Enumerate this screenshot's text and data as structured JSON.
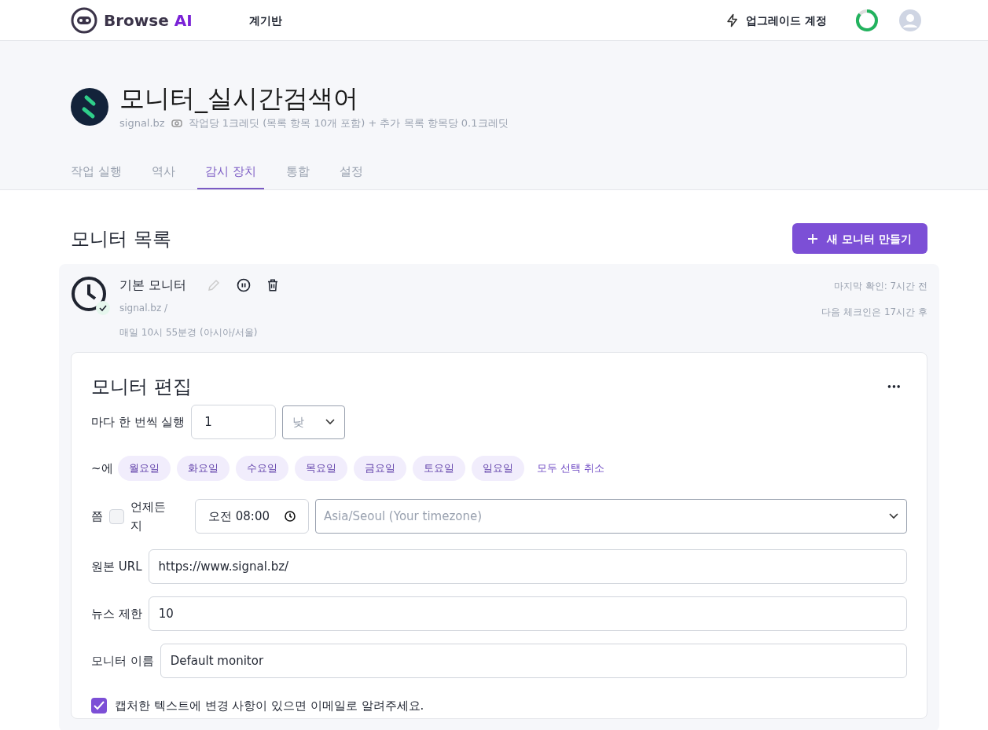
{
  "header": {
    "brand": {
      "name": "Browse ",
      "accent": "AI"
    },
    "nav": [
      {
        "label": "계기반",
        "selected": true
      }
    ],
    "upgrade": "업그레이드 계정"
  },
  "robot": {
    "title": "모니터_실시간검색어",
    "domain": "signal.bz",
    "credits": "작업당 1크레딧 (목록 항목 10개 포함) + 추가 목록 항목당 0.1크레딧"
  },
  "tabs": [
    {
      "label": "작업 실행",
      "selected": false
    },
    {
      "label": "역사",
      "selected": false
    },
    {
      "label": "감시 장치",
      "selected": true
    },
    {
      "label": "통합",
      "selected": false
    },
    {
      "label": "설정",
      "selected": false
    }
  ],
  "monitors_heading": "모니터 목록",
  "new_monitor_button": "새 모니터 만들기",
  "monitor": {
    "name": "기본 모니터",
    "url": "signal.bz /",
    "schedule": "매일 10시 55분경 (아시아/서울)",
    "active": true,
    "last_check": "마지막 확인: 7시간 전",
    "next_check": "다음 체크인은 17시간 후"
  },
  "edit": {
    "title": "모니터 편집",
    "more": "•••",
    "run_every_label": "마다 한 번씩 실행",
    "interval": "1",
    "unit_placeholder": "낮",
    "on_label": "~에",
    "days": [
      {
        "label": "월요일",
        "selected": true
      },
      {
        "label": "화요일",
        "selected": true
      },
      {
        "label": "수요일",
        "selected": true
      },
      {
        "label": "목요일",
        "selected": true
      },
      {
        "label": "금요일",
        "selected": true
      },
      {
        "label": "토요일",
        "selected": true
      },
      {
        "label": "일요일",
        "selected": true
      }
    ],
    "deselect_all": "모두 선택 취소",
    "at_label": "쯤",
    "anytime": {
      "label": "언제든지",
      "checked": false
    },
    "time": "오전 08:00",
    "timezone_placeholder": "Asia/Seoul (Your timezone)",
    "fields": [
      {
        "label": "원본 URL",
        "value": "https://www.signal.bz/"
      },
      {
        "label": "뉴스 제한",
        "value": "10"
      },
      {
        "label": "모니터 이름",
        "value": "Default monitor"
      }
    ],
    "notify": {
      "label": "캡처한 텍스트에 변경 사항이 있으면 이메일로 알려주세요.",
      "checked": true
    }
  }
}
